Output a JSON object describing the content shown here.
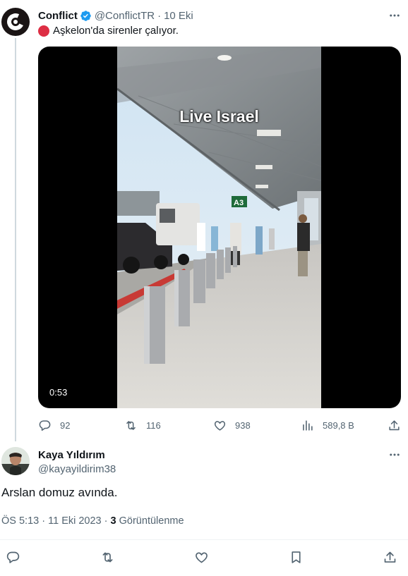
{
  "tweet": {
    "author_name": "Conflict",
    "author_handle": "@ConflictTR",
    "separator": "·",
    "date": "10 Eki",
    "text": "Aşkelon'da sirenler çalıyor.",
    "video": {
      "overlay_text": "Live Israel",
      "duration": "0:53",
      "sign_text": "A3"
    },
    "stats": {
      "replies": "92",
      "retweets": "116",
      "likes": "938",
      "views": "589,8 B"
    }
  },
  "reply": {
    "author_name": "Kaya Yıldırım",
    "author_handle": "@kayayildirim38",
    "text": "Arslan domuz avında.",
    "time": "ÖS 5:13",
    "separator": "·",
    "date": "11 Eki 2023",
    "views_count": "3",
    "views_label": "Görüntülenme"
  },
  "colors": {
    "text_primary": "#0f1419",
    "text_secondary": "#536471",
    "verified_blue": "#1d9bf0",
    "red_circle": "#dd2e44",
    "thread_line": "#cfd9de"
  }
}
